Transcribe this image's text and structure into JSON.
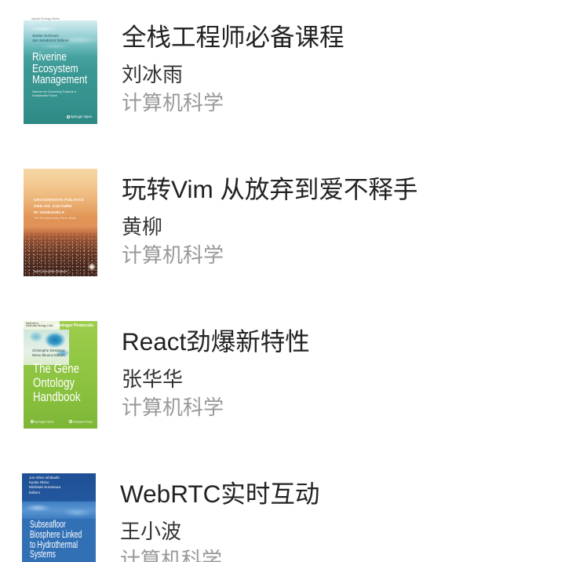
{
  "theme": {
    "background": "#ffffff",
    "title_color": "#222222",
    "author_color": "#333333",
    "category_color": "#999999"
  },
  "books": [
    {
      "title": "全栈工程师必备课程",
      "author": "刘冰雨",
      "category": "计算机科学",
      "cover": {
        "series": "Aquatic Ecology Series",
        "editors": [
          "Stefan Schmutz",
          "Jan Sendzimir Editors"
        ],
        "title_lines": [
          "Riverine",
          "Ecosystem",
          "Management"
        ],
        "subtitle_lines": [
          "Science for Governing Towards a",
          "Sustainable Future"
        ],
        "publisher": "Springer Open"
      }
    },
    {
      "title": "玩转Vim 从放弃到爱不释手",
      "author": "黄柳",
      "category": "计算机科学",
      "cover": {
        "title_lines": [
          "GRASSROOTS POLITICS",
          "AND OIL CULTURE",
          "IN VENEZUELA"
        ],
        "subtitle": "The Revolutionary Petro-State",
        "author": "Iselin Åsedotter Strønen"
      }
    },
    {
      "title": "React劲爆新特性",
      "author": "张华华",
      "category": "计算机科学",
      "cover": {
        "series_lines": [
          "Methods in",
          "Molecular Biology 1446"
        ],
        "series_brand": "Springer Protocols",
        "editors": [
          "Christophe Dessimoz",
          "Nives Škunca Editors"
        ],
        "title_lines": [
          "The Gene",
          "Ontology",
          "Handbook"
        ],
        "publishers": [
          "Springer Open",
          "Humana Press"
        ]
      }
    },
    {
      "title": "WebRTC实时互动",
      "author": "王小波",
      "category": "计算机科学",
      "cover": {
        "editors": [
          "Jun-ichiro Ishibashi",
          "Kyoko Okino",
          "Michinari Sunamura",
          "Editors"
        ],
        "title_lines": [
          "Subseafloor",
          "Biosphere Linked",
          "to Hydrothermal",
          "Systems"
        ]
      }
    }
  ]
}
